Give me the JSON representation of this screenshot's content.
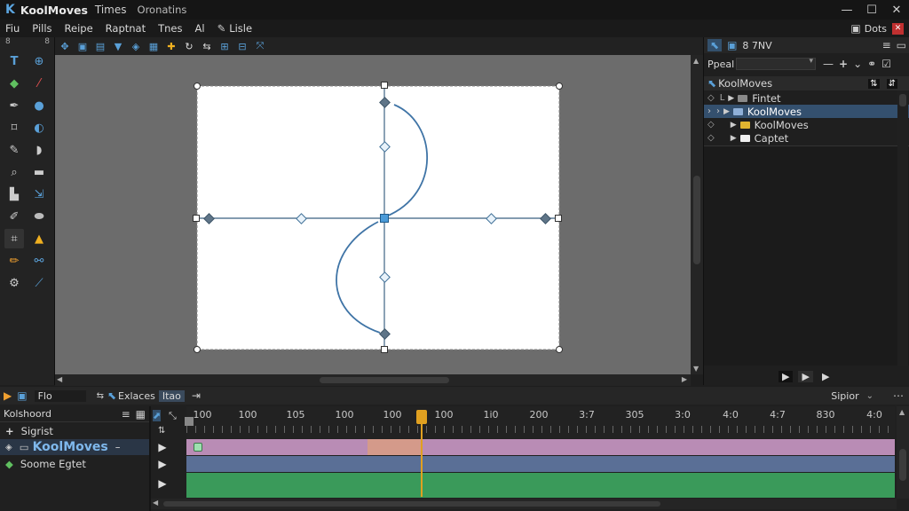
{
  "app": {
    "logo_text": "K",
    "title": "KoolMoves",
    "title_extra": "Times",
    "title_extra2": "Oronatins",
    "menu": [
      "Fiu",
      "Pills",
      "Reipe",
      "Raptnat",
      "Tnes",
      "Al",
      "Lisle"
    ],
    "menu_icon": "pencil-icon"
  },
  "window_controls": {
    "minimize": "—",
    "maximize": "☐",
    "close": "✕",
    "dots_label": "Dots"
  },
  "toolbox": {
    "header_left": "8",
    "header_right": "8",
    "tools": [
      "text-tool-icon",
      "plus-circle-icon",
      "paint-bucket-icon",
      "pipette-icon",
      "pen-icon",
      "ellipse-icon",
      "lasso-icon",
      "oval-icon",
      "brush-icon",
      "shape-icon",
      "zoom-icon",
      "box-icon",
      "select-icon",
      "transform-icon",
      "eraser-icon",
      "sphere-icon",
      "node-icon",
      "bell-icon",
      "pencil-icon",
      "link-icon",
      "gear-icon",
      "line-icon"
    ]
  },
  "right_panel": {
    "tabs_label": "8 7NV",
    "search_label": "Ppeal",
    "tree_title": "KoolMoves",
    "tree": [
      {
        "label": "Fintet",
        "color": "#8a8a8a",
        "selected": false
      },
      {
        "label": "KoolMoves",
        "color": "#8fb0d8",
        "selected": true
      },
      {
        "label": "KoolMoves",
        "color": "#e0b430",
        "selected": false
      },
      {
        "label": "Captet",
        "color": "#f0f0f0",
        "selected": false
      }
    ],
    "play_buttons": [
      "▶",
      "▶",
      "▶"
    ]
  },
  "timeline": {
    "header": {
      "file_label": "Flo",
      "tab1": "Exlaces",
      "tab2": "Itao",
      "right_label": "Sipior"
    },
    "layers_title": "Kolshoord",
    "layers": [
      {
        "label": "Sigrist",
        "icon": "plus-icon"
      },
      {
        "label": "KoolMoves",
        "icon": "eye-icon",
        "bold": true
      },
      {
        "label": "Soome  Egtet",
        "icon": "diamond-icon"
      }
    ],
    "ruler": [
      "100",
      "100",
      "105",
      "100",
      "100",
      "100",
      "1i0",
      "200",
      "3:7",
      "305",
      "3:0",
      "4:0",
      "4:7",
      "830",
      "4:0"
    ],
    "playhead_frame": 100
  },
  "colors": {
    "accent": "#4a90d0",
    "track_pink": "#b98cb5",
    "track_blue": "#5a6f96",
    "track_green": "#3a9a5a",
    "playhead": "#e0a020"
  }
}
